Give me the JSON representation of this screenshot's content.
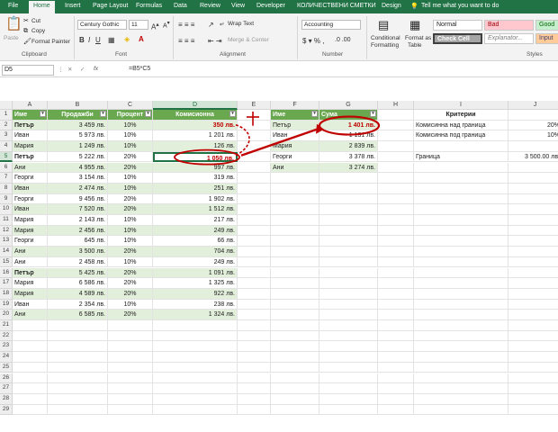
{
  "ribbon_tabs": [
    "File",
    "Home",
    "Insert",
    "Page Layout",
    "Formulas",
    "Data",
    "Review",
    "View",
    "Developer",
    "КОЛИЧЕСТВЕНИ СМЕТКИ",
    "Design"
  ],
  "tell_me": "Tell me what you want to do",
  "clipboard": {
    "paste": "Paste",
    "cut": "Cut",
    "copy": "Copy",
    "painter": "Format Painter",
    "label": "Clipboard"
  },
  "font": {
    "name": "Century Gothic",
    "size": "11",
    "label": "Font"
  },
  "alignment": {
    "wrap": "Wrap Text",
    "merge": "Merge & Center",
    "label": "Alignment"
  },
  "number": {
    "format": "Accounting",
    "label": "Number"
  },
  "styles": {
    "cond": "Conditional",
    "cond2": "Formatting",
    "fmt": "Format as",
    "fmt2": "Table",
    "normal": "Normal",
    "bad": "Bad",
    "good": "Good",
    "check": "Check Cell",
    "expl": "Explanator...",
    "input": "Input",
    "label": "Styles"
  },
  "formula_bar": {
    "name_box": "D5",
    "cancel": "✕",
    "enter": "✓",
    "fx": "fx",
    "formula": "=B5*C5"
  },
  "columns": [
    "A",
    "B",
    "C",
    "D",
    "E",
    "F",
    "G",
    "H",
    "I",
    "J"
  ],
  "main_table": {
    "headers": [
      "Име",
      "Продажби",
      "Процент",
      "Комисионна"
    ],
    "rows": [
      [
        "Петър",
        "3 459 лв.",
        "10%",
        "350 лв."
      ],
      [
        "Иван",
        "5 973 лв.",
        "10%",
        "1 201 лв."
      ],
      [
        "Мария",
        "1 249 лв.",
        "10%",
        "126 лв."
      ],
      [
        "Петър",
        "5 222 лв.",
        "20%",
        "1 050 лв."
      ],
      [
        "Ани",
        "4 955 лв.",
        "20%",
        "997 лв."
      ],
      [
        "Георги",
        "3 154 лв.",
        "10%",
        "319 лв."
      ],
      [
        "Иван",
        "2 474 лв.",
        "10%",
        "251 лв."
      ],
      [
        "Георги",
        "9 456 лв.",
        "20%",
        "1 902 лв."
      ],
      [
        "Иван",
        "7 520 лв.",
        "20%",
        "1 512 лв."
      ],
      [
        "Мария",
        "2 143 лв.",
        "10%",
        "217 лв."
      ],
      [
        "Мария",
        "2 456 лв.",
        "10%",
        "249 лв."
      ],
      [
        "Георги",
        "645 лв.",
        "10%",
        "66 лв."
      ],
      [
        "Ани",
        "3 500 лв.",
        "20%",
        "704 лв."
      ],
      [
        "Ани",
        "2 458 лв.",
        "10%",
        "249 лв."
      ],
      [
        "Петър",
        "5 425 лв.",
        "20%",
        "1 091 лв."
      ],
      [
        "Мария",
        "6 586 лв.",
        "20%",
        "1 325 лв."
      ],
      [
        "Мария",
        "4 589 лв.",
        "20%",
        "922 лв."
      ],
      [
        "Иван",
        "2 354 лв.",
        "10%",
        "238 лв."
      ],
      [
        "Ани",
        "6 585 лв.",
        "20%",
        "1 324 лв."
      ]
    ]
  },
  "summary_table": {
    "headers": [
      "Име",
      "Сума"
    ],
    "rows": [
      [
        "Петър",
        "1 401 лв."
      ],
      [
        "Иван",
        "1 131 лв."
      ],
      [
        "Мария",
        "2 839 лв."
      ],
      [
        "Георги",
        "3 378 лв."
      ],
      [
        "Ани",
        "3 274 лв."
      ]
    ]
  },
  "criteria": {
    "title": "Критерии",
    "row1_label": "Комисинна над граница",
    "row1_value": "20%",
    "row2_label": "Комисинна под граница",
    "row2_value": "10%",
    "row3_label": "Граница",
    "row3_value": "3 500.00 лв."
  },
  "accent_color": "#217346",
  "annotation_color": "#c00000"
}
